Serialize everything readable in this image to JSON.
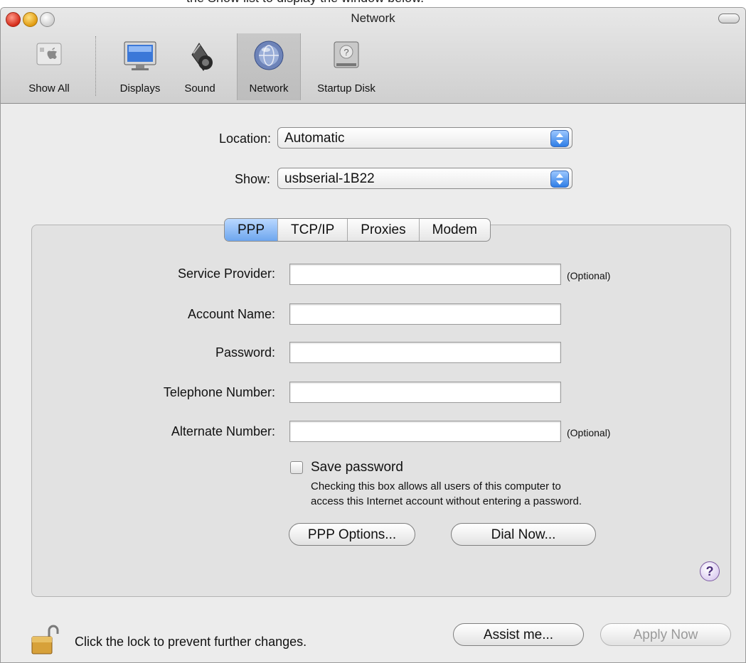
{
  "top_caption": "the Show list to display the window below.",
  "window": {
    "title": "Network"
  },
  "toolbar": {
    "items": [
      {
        "label": "Show All",
        "icon": "apple-show-all-icon"
      },
      {
        "label": "Displays",
        "icon": "display-monitor-icon"
      },
      {
        "label": "Sound",
        "icon": "speaker-icon"
      },
      {
        "label": "Network",
        "icon": "network-globe-icon",
        "selected": true
      },
      {
        "label": "Startup Disk",
        "icon": "hard-disk-icon"
      }
    ]
  },
  "location": {
    "label": "Location:",
    "value": "Automatic"
  },
  "show": {
    "label": "Show:",
    "value": "usbserial-1B22"
  },
  "tabs": [
    {
      "label": "PPP",
      "active": true
    },
    {
      "label": "TCP/IP",
      "active": false
    },
    {
      "label": "Proxies",
      "active": false
    },
    {
      "label": "Modem",
      "active": false
    }
  ],
  "fields": {
    "service_provider": {
      "label": "Service Provider:",
      "value": "",
      "note": "(Optional)"
    },
    "account_name": {
      "label": "Account Name:",
      "value": ""
    },
    "password": {
      "label": "Password:",
      "value": ""
    },
    "telephone_number": {
      "label": "Telephone Number:",
      "value": ""
    },
    "alternate_number": {
      "label": "Alternate Number:",
      "value": "",
      "note": "(Optional)"
    }
  },
  "save_password": {
    "label": "Save password",
    "checked": false,
    "hint_line1": "Checking this box allows all users of this computer to",
    "hint_line2": "access this Internet account without entering a password."
  },
  "buttons": {
    "ppp_options": "PPP Options...",
    "dial_now": "Dial Now...",
    "help": "?",
    "assist_me": "Assist me...",
    "apply_now": "Apply Now"
  },
  "lock": {
    "text": "Click the lock to prevent further changes.",
    "icon": "unlocked-padlock-icon"
  },
  "colors": {
    "accent": "#6ea6ee",
    "window_bg": "#ececec",
    "help_accent": "#4a2c7a"
  }
}
